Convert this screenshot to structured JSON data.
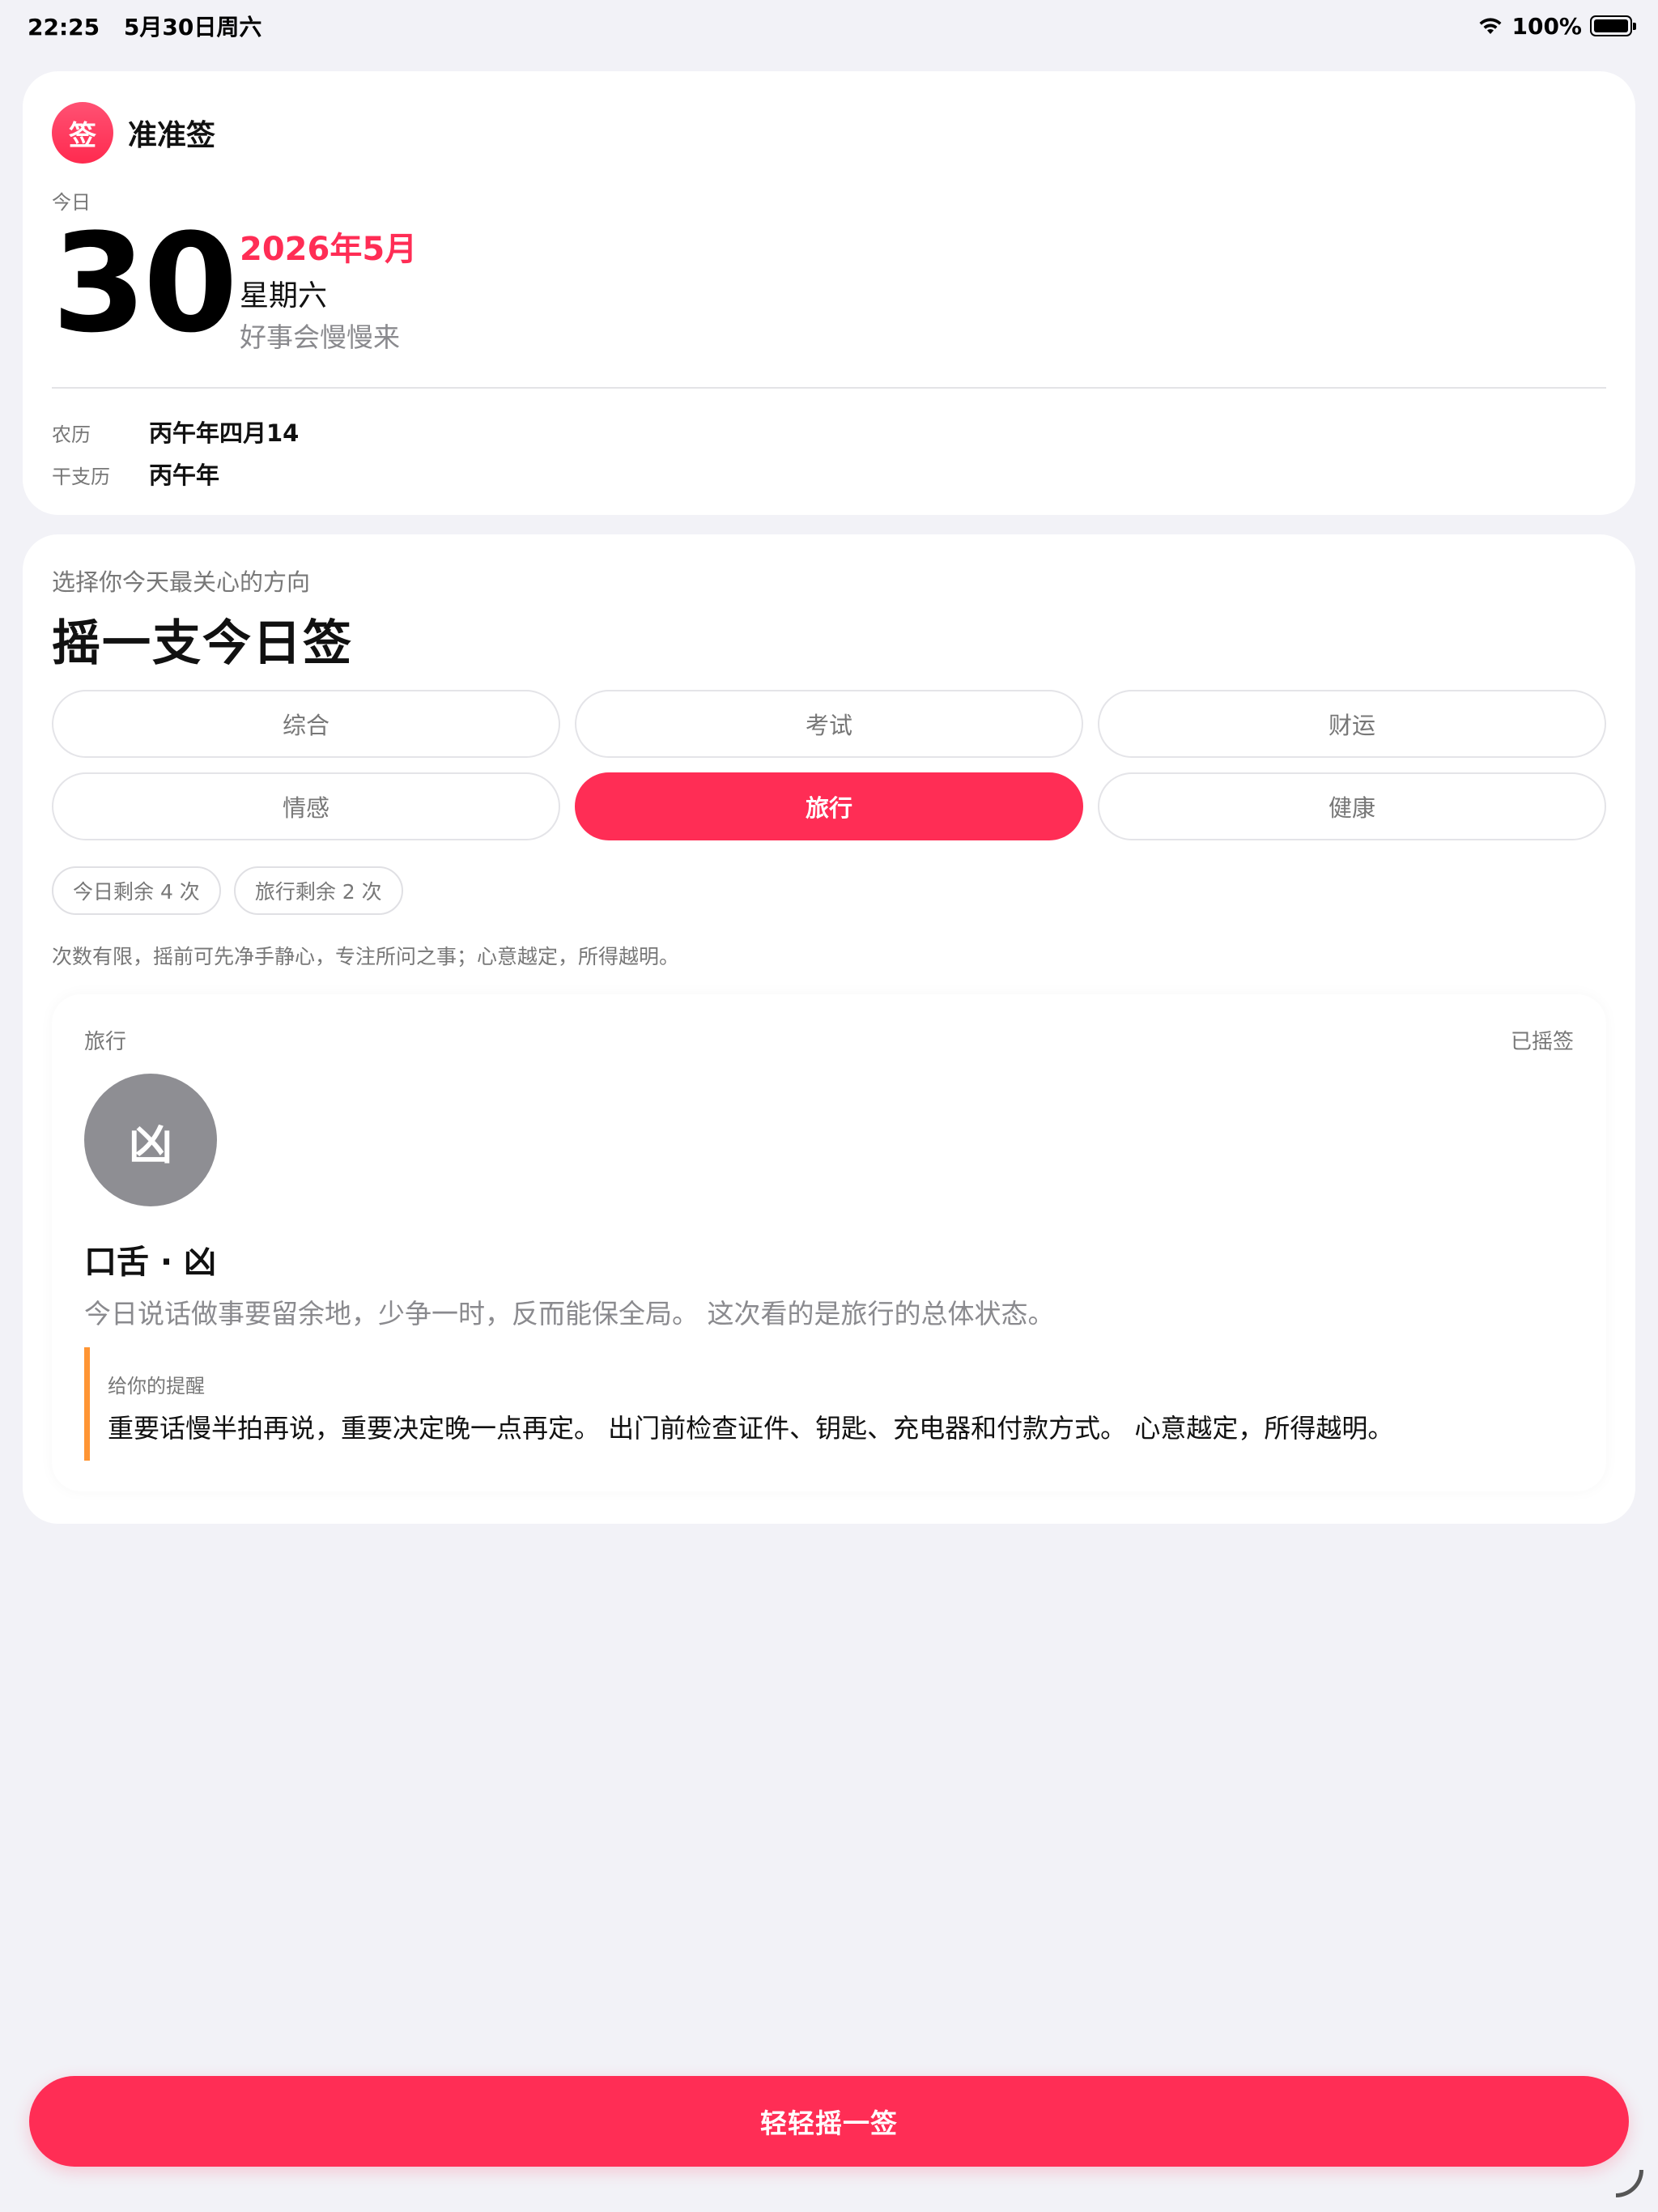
{
  "status_bar": {
    "time": "22:25",
    "date": "5月30日周六",
    "battery": "100%"
  },
  "app": {
    "logo_char": "签",
    "name": "准准签"
  },
  "today": {
    "label": "今日",
    "day": "30",
    "year_month": "2026年5月",
    "weekday": "星期六",
    "slogan": "好事会慢慢来"
  },
  "calendar": {
    "lunar_label": "农历",
    "lunar_value": "丙午年四月14",
    "ganzhi_label": "干支历",
    "ganzhi_value": "丙午年"
  },
  "draw": {
    "subtitle": "选择你今天最关心的方向",
    "title": "摇一支今日签",
    "categories": [
      "综合",
      "考试",
      "财运",
      "情感",
      "旅行",
      "健康"
    ],
    "selected_category": "旅行",
    "remaining_today": "今日剩余 4 次",
    "remaining_category": "旅行剩余 2 次",
    "hint": "次数有限，摇前可先净手静心，专注所问之事；心意越定，所得越明。"
  },
  "result": {
    "category": "旅行",
    "status": "已摇签",
    "fortune_char": "凶",
    "title": "口舌 · 凶",
    "description": "今日说话做事要留余地，少争一时，反而能保全局。 这次看的是旅行的总体状态。",
    "advice_label": "给你的提醒",
    "advice_text": "重要话慢半拍再说，重要决定晚一点再定。 出门前检查证件、钥匙、充电器和付款方式。 心意越定，所得越明。"
  },
  "shake_button": "轻轻摇一签",
  "colors": {
    "accent": "#ff2d55",
    "advice_bar": "#ff9533",
    "fortune_circle": "#8e8e93",
    "background": "#f2f2f7"
  }
}
